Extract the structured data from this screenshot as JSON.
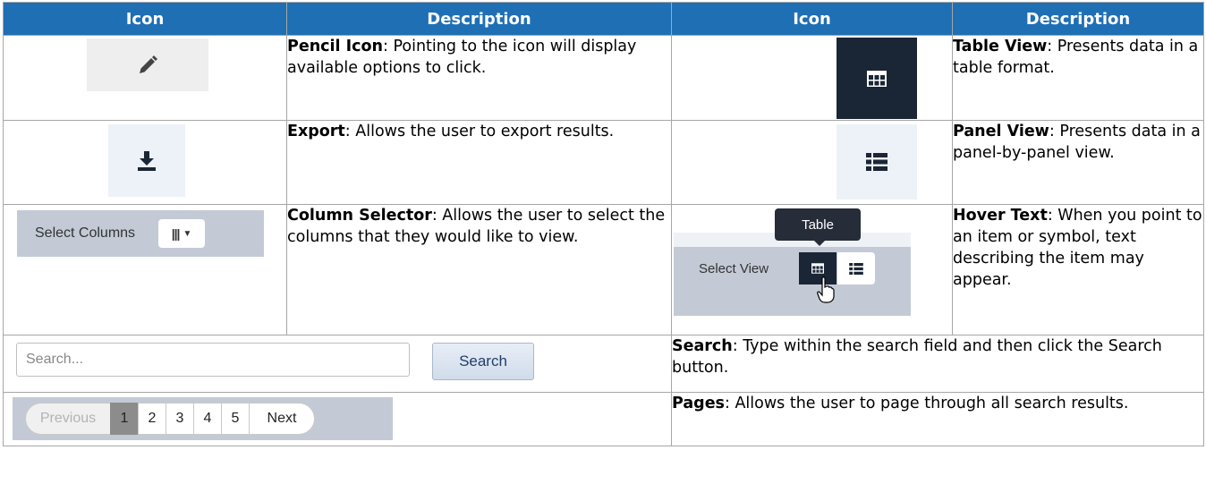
{
  "headers": [
    "Icon",
    "Description",
    "Icon",
    "Description"
  ],
  "rows": [
    {
      "left_title": "Pencil Icon",
      "left_text": ": Pointing to the icon will display available options to click.",
      "right_title": "Table View",
      "right_text": ": Presents data in a table format."
    },
    {
      "left_title": "Export",
      "left_text": ": Allows the user to export results.",
      "right_title": "Panel View",
      "right_text": ": Presents data in a panel-by-panel view."
    },
    {
      "left_title": "Column Selector",
      "left_text": ": Allows the user to select the columns that they would like to view.",
      "right_title": "Hover Text",
      "right_text": ": When you point to an item or symbol, text describing the item may appear."
    }
  ],
  "column_selector": {
    "label": "Select Columns",
    "button": "|||"
  },
  "hover_demo": {
    "tooltip": "Table",
    "label": "Select View"
  },
  "search_row": {
    "placeholder": "Search...",
    "button": "Search",
    "title": "Search",
    "text": ": Type within the search field and then click the Search button."
  },
  "pages_row": {
    "previous": "Previous",
    "pages": [
      "1",
      "2",
      "3",
      "4",
      "5"
    ],
    "active_page": "1",
    "next": "Next",
    "title": "Pages",
    "text": ": Allows the user to page through all search results."
  },
  "colors": {
    "header_bg": "#1f6fb5",
    "dark_button": "#1a2535",
    "toolbar_gray": "#c3cad6"
  },
  "icons": [
    "pencil-icon",
    "download-icon",
    "grid-icon",
    "list-icon",
    "columns-icon",
    "hand-cursor-icon"
  ]
}
